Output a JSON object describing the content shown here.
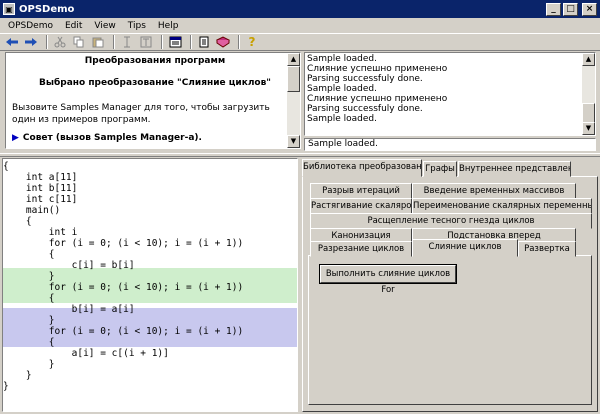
{
  "window": {
    "title": "OPSDemo",
    "min": "_",
    "max": "□",
    "close": "×"
  },
  "menu": [
    "OPSDemo",
    "Edit",
    "View",
    "Tips",
    "Help"
  ],
  "toolbar_icons": [
    "back-arrow",
    "forward-arrow",
    "cut",
    "copy",
    "paste",
    "text-cursor",
    "format-text",
    "calendar",
    "list",
    "book",
    "help"
  ],
  "doc": {
    "heading": "Преобразования программ",
    "subheading": "Выбрано преобразование \"Слияние циклов\"",
    "paragraph": "Вызовите Samples Manager для того, чтобы загрузить один из примеров программ.",
    "tip": "Совет (вызов Samples Manager-а)."
  },
  "log": [
    "Sample loaded.",
    "Слияние успешно применено",
    "Parsing successfuly done.",
    "Sample loaded.",
    "Слияние успешно применено",
    "Parsing successfuly done.",
    "Sample loaded."
  ],
  "status": "Sample loaded.",
  "code": [
    "{",
    "    int a[11]",
    "    int b[11]",
    "    int c[11]",
    "    main()",
    "    {",
    "        int i",
    "        for (i = 0; (i < 10); i = (i + 1))",
    "        {",
    "            c[i] = b[i]",
    "        }",
    "        for (i = 0; (i < 10); i = (i + 1))",
    "        {",
    "            b[i] = a[i]",
    "        }",
    "        for (i = 0; (i < 10); i = (i + 1))",
    "        {",
    "            a[i] = c[(i + 1)]",
    "        }",
    "    }",
    "}"
  ],
  "tabs_top": [
    "Библиотека преобразований",
    "Графы",
    "Внутреннее представление"
  ],
  "transform_tabs": {
    "row1": [
      "Разрыв итераций",
      "Введение временных массивов"
    ],
    "row2": [
      "Растягивание скаляров",
      "Переименование скалярных переменных"
    ],
    "row3": [
      "Расщепление тесного гнезда циклов"
    ],
    "row4": [
      "Канонизация",
      "Подстановка вперед"
    ],
    "row5": [
      "Разрезание циклов",
      "Слияние циклов",
      "Развертка"
    ]
  },
  "action_button": "Выполнить слияние циклов For"
}
